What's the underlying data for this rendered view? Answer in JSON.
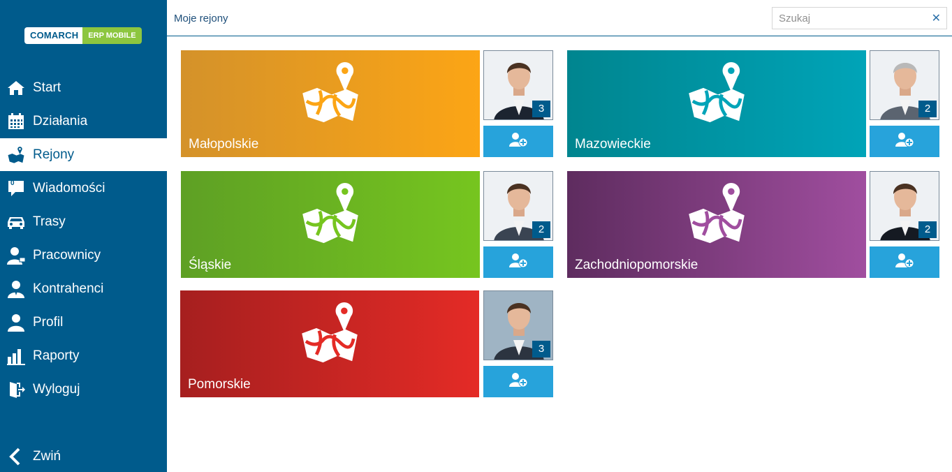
{
  "logo": {
    "part1": "COMARCH",
    "part2": "ERP MOBILE"
  },
  "nav": [
    {
      "label": "Start",
      "icon": "home-icon"
    },
    {
      "label": "Działania",
      "icon": "calendar-icon"
    },
    {
      "label": "Rejony",
      "icon": "map-icon",
      "active": true
    },
    {
      "label": "Wiadomości",
      "icon": "message-icon",
      "badge": "0"
    },
    {
      "label": "Trasy",
      "icon": "car-icon"
    },
    {
      "label": "Pracownicy",
      "icon": "employee-icon"
    },
    {
      "label": "Kontrahenci",
      "icon": "contractor-icon"
    },
    {
      "label": "Profil",
      "icon": "profile-icon"
    },
    {
      "label": "Raporty",
      "icon": "bar-chart-icon"
    },
    {
      "label": "Wyloguj",
      "icon": "logout-icon"
    },
    {
      "label": "Zwiń",
      "icon": "chevron-left-icon"
    }
  ],
  "header": {
    "title": "Moje rejony",
    "search_placeholder": "Szukaj",
    "clear_icon": "close-icon"
  },
  "regions": [
    {
      "name": "Małopolskie",
      "count": "3",
      "colors": [
        "#d4922a",
        "#fca515"
      ]
    },
    {
      "name": "Mazowieckie",
      "count": "2",
      "colors": [
        "#00858f",
        "#00a4b8"
      ]
    },
    {
      "name": "Śląskie",
      "count": "2",
      "colors": [
        "#5ea024",
        "#76c51f"
      ]
    },
    {
      "name": "Zachodniopomorskie",
      "count": "2",
      "colors": [
        "#5e2c5f",
        "#a04e9f"
      ]
    },
    {
      "name": "Pomorskie",
      "count": "3",
      "colors": [
        "#a61f1f",
        "#e42b26"
      ]
    }
  ],
  "accent": "#005b8c",
  "button_color": "#27a3db"
}
